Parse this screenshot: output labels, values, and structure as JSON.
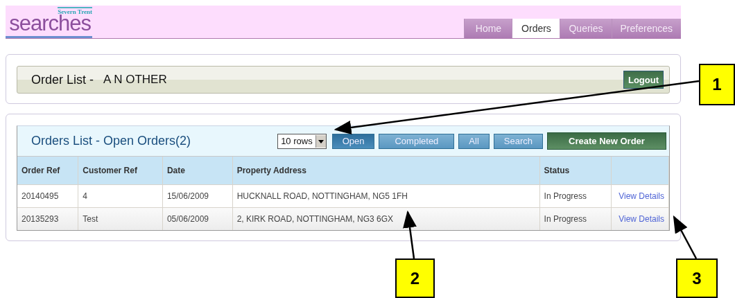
{
  "header": {
    "logo": {
      "tagline": "Severn Trent",
      "name": "searches"
    },
    "tabs": [
      {
        "label": "Home",
        "selected": false
      },
      {
        "label": "Orders",
        "selected": true
      },
      {
        "label": "Queries",
        "selected": false
      },
      {
        "label": "Preferences",
        "selected": false
      }
    ]
  },
  "user_bar": {
    "title": "Order List -",
    "user": "A N OTHER",
    "logout": "Logout"
  },
  "orders": {
    "title": "Orders List - Open Orders(2)",
    "rows_select": "10 rows",
    "filters": [
      {
        "label": "Open",
        "selected": true
      },
      {
        "label": "Completed",
        "selected": false
      },
      {
        "label": "All",
        "selected": false
      },
      {
        "label": "Search",
        "selected": false
      }
    ],
    "create_button": "Create New Order",
    "columns": [
      "Order Ref",
      "Customer Ref",
      "Date",
      "Property Address",
      "Status"
    ],
    "rows": [
      {
        "cells": [
          "20140495",
          "4",
          "15/06/2009",
          "HUCKNALL ROAD, NOTTINGHAM, NG5 1FH",
          "In Progress"
        ],
        "link": "View Details"
      },
      {
        "cells": [
          "20135293",
          "Test",
          "05/06/2009",
          "2, KIRK ROAD, NOTTINGHAM, NG3 6GX",
          "In Progress"
        ],
        "link": "View Details"
      }
    ]
  },
  "callouts": [
    "1",
    "2",
    "3"
  ]
}
